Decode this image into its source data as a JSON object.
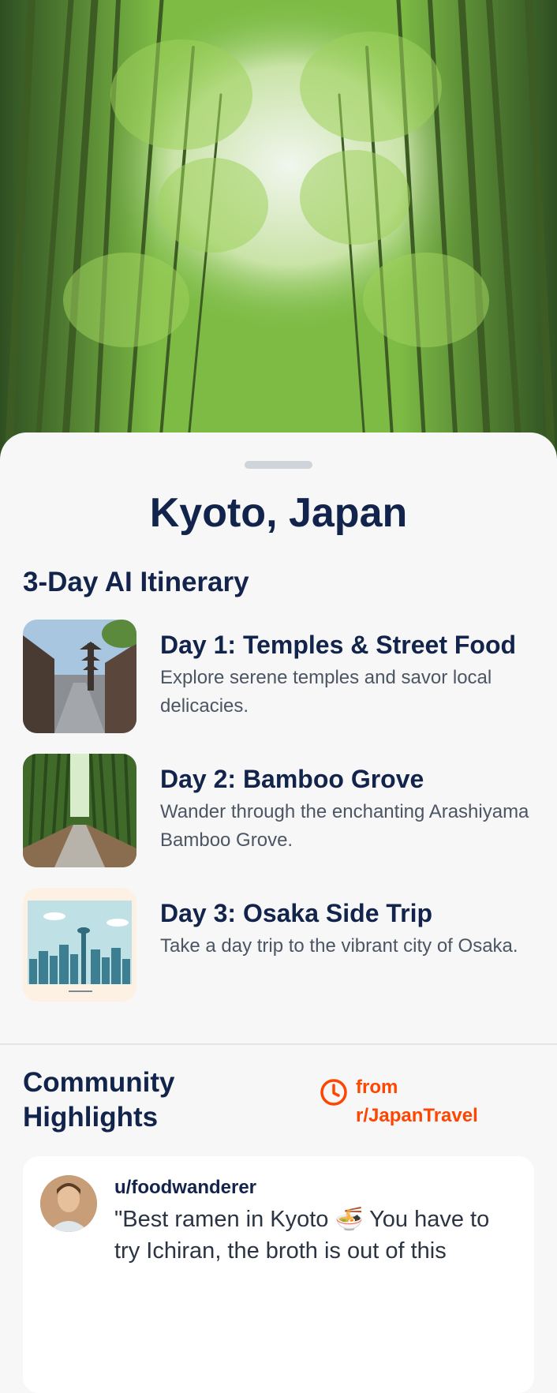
{
  "destination": {
    "title": "Kyoto, Japan"
  },
  "itinerary": {
    "heading": "3-Day AI Itinerary",
    "days": [
      {
        "title": "Day 1: Temples & Street Food",
        "description": "Explore serene temples and savor local delicacies.",
        "image": "kyoto-street-pagoda"
      },
      {
        "title": "Day 2: Bamboo Grove",
        "description": "Wander through the enchanting Arashiyama Bamboo Grove.",
        "image": "bamboo-grove-path"
      },
      {
        "title": "Day 3: Osaka Side Trip",
        "description": "Take a day trip to the vibrant city of Osaka.",
        "image": "osaka-skyline-illustration"
      }
    ]
  },
  "community": {
    "heading": "Community Highlights",
    "source_label": "from r/JapanTravel",
    "source_icon": "clock-icon",
    "post": {
      "username": "u/foodwanderer",
      "quote": "\"Best ramen in Kyoto 🍜 You have to try Ichiran, the broth is out of this"
    }
  },
  "colors": {
    "primary_text": "#12244b",
    "accent": "#ff4500",
    "sheet_bg": "#f7f7f8"
  }
}
